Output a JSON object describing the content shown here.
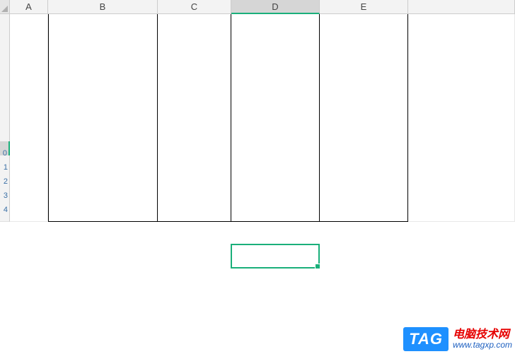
{
  "columns": [
    "A",
    "B",
    "C",
    "D",
    "E",
    ""
  ],
  "selected_column_index": 3,
  "row_headers": [
    "",
    "",
    "",
    "",
    "",
    "",
    "",
    "",
    "",
    "0",
    "1",
    "2",
    "3",
    "4"
  ],
  "selected_row_index": 9,
  "table": {
    "first_data_row": 0,
    "last_data_row": 13,
    "first_col": 1,
    "last_col": 4
  },
  "active_cell": {
    "col": 3,
    "row": 9
  },
  "watermark": {
    "tag": "TAG",
    "title": "电脑技术网",
    "url": "www.tagxp.com"
  },
  "chart_data": null
}
